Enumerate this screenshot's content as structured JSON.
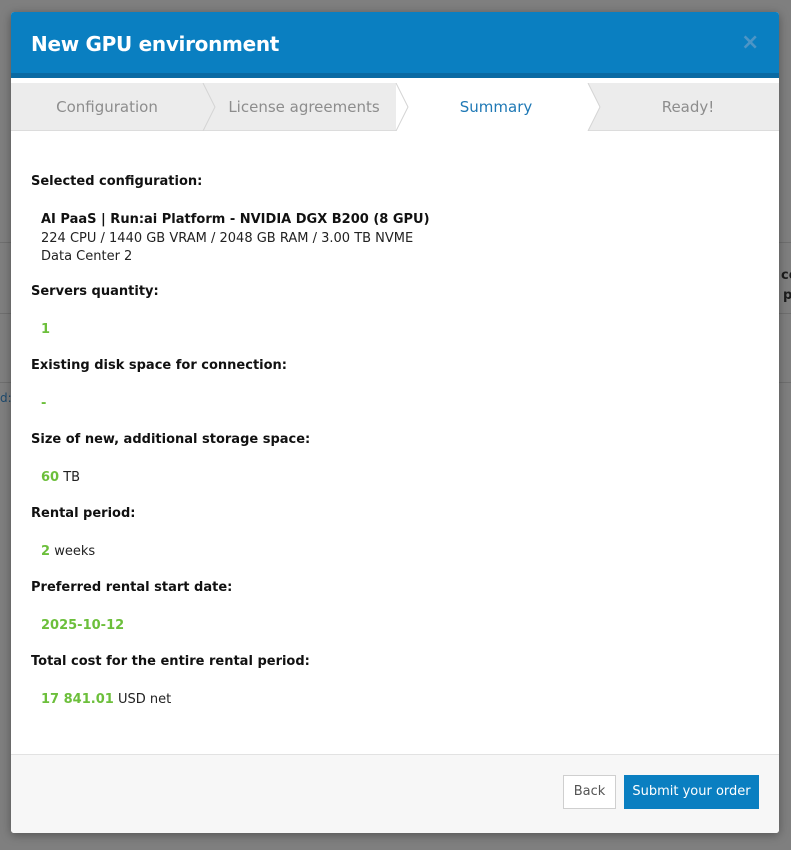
{
  "background": {
    "fragment_1": "ce",
    "fragment_2": "p",
    "fragment_3": "d:"
  },
  "modal": {
    "title": "New GPU environment",
    "close_glyph": "×"
  },
  "steps": [
    {
      "label": "Configuration",
      "active": false
    },
    {
      "label": "License agreements",
      "active": false
    },
    {
      "label": "Summary",
      "active": true
    },
    {
      "label": "Ready!",
      "active": false
    }
  ],
  "summary": {
    "selected_configuration_label": "Selected configuration:",
    "configuration_name": "AI PaaS | Run:ai Platform - NVIDIA DGX B200 (8 GPU)",
    "configuration_specs": "224 CPU / 1440 GB VRAM / 2048 GB RAM / 3.00 TB NVME",
    "configuration_location": "Data Center 2",
    "servers_quantity_label": "Servers quantity:",
    "servers_quantity_value": "1",
    "existing_disk_label": "Existing disk space for connection:",
    "existing_disk_value": "-",
    "new_storage_label": "Size of new, additional storage space:",
    "new_storage_value": "60",
    "new_storage_unit": "TB",
    "rental_period_label": "Rental period:",
    "rental_period_value": "2",
    "rental_period_unit": "weeks",
    "start_date_label": "Preferred rental start date:",
    "start_date_value": "2025-10-12",
    "total_cost_label": "Total cost for the entire rental period:",
    "total_cost_value": "17 841.01",
    "total_cost_unit": "USD net"
  },
  "footer": {
    "back_label": "Back",
    "submit_label": "Submit your order"
  },
  "colors": {
    "header_blue": "#0a7fc1",
    "value_green": "#6cbf3b",
    "active_step": "#1e78b5"
  }
}
